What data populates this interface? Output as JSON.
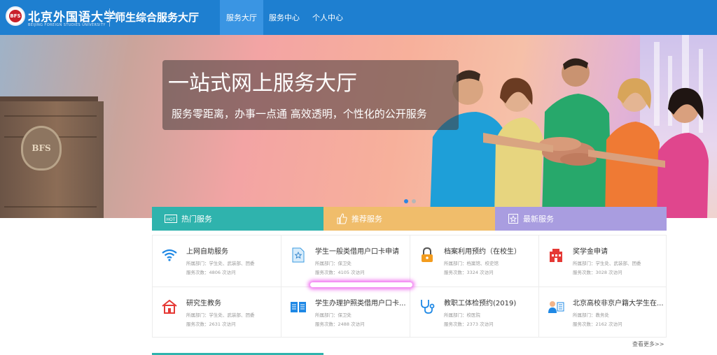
{
  "header": {
    "logo_text": "BFS",
    "university_name": "北京外国语大学",
    "university_en": "BEIJING FOREIGN STUDIES UNIVERSITY",
    "system_title": "师生综合服务大厅",
    "nav": [
      {
        "label": "服务大厅",
        "active": true
      },
      {
        "label": "服务中心",
        "active": false
      },
      {
        "label": "个人中心",
        "active": false
      }
    ]
  },
  "banner": {
    "headline": "一站式网上服务大厅",
    "subheadline": "服务零距离，办事一点通 高效透明，个性化的公开服务",
    "emblem_text": "BFS",
    "carousel_dots": 2,
    "active_dot": 0
  },
  "tabs": [
    {
      "label": "热门服务",
      "icon": "hot-icon",
      "color": "#2fb3ad"
    },
    {
      "label": "推荐服务",
      "icon": "thumbs-up-icon",
      "color": "#f0bd6b"
    },
    {
      "label": "最新服务",
      "icon": "new-badge-icon",
      "color": "#a99de0"
    }
  ],
  "services": [
    {
      "title": "上网自助服务",
      "dept": "所属部门：学生处、武装部、团委",
      "count": "服务次数：4806 次访问",
      "icon": "wifi-icon"
    },
    {
      "title": "学生一般类借用户口卡申请",
      "dept": "所属部门：保卫处",
      "count": "服务次数：4105 次访问",
      "icon": "document-star-icon"
    },
    {
      "title": "档案利用预约（在校生）",
      "dept": "所属部门：档案馆、校史馆",
      "count": "服务次数：3324 次访问",
      "icon": "lock-icon"
    },
    {
      "title": "奖学金申请",
      "dept": "所属部门：学生处、武装部、团委",
      "count": "服务次数：3028 次访问",
      "icon": "building-icon"
    },
    {
      "title": "研究生教务",
      "dept": "所属部门：学生处、武装部、团委",
      "count": "服务次数：2631 次访问",
      "icon": "house-icon"
    },
    {
      "title": "学生办理护照类借用户口卡...",
      "dept": "所属部门：保卫处",
      "count": "服务次数：2488 次访问",
      "icon": "open-book-icon"
    },
    {
      "title": "教职工体检预约(2019)",
      "dept": "所属部门：校医院",
      "count": "服务次数：2373 次访问",
      "icon": "stethoscope-icon"
    },
    {
      "title": "北京高校非京户籍大学生在...",
      "dept": "所属部门：教务处",
      "count": "服务次数：2162 次访问",
      "icon": "person-card-icon"
    }
  ],
  "more_link": "查看更多>>",
  "colors": {
    "header_bg": "#1e7fd0",
    "nav_active_bg": "#3a95e3",
    "hot_tab": "#2fb3ad",
    "recommend_tab": "#f0bd6b",
    "latest_tab": "#a99de0"
  }
}
